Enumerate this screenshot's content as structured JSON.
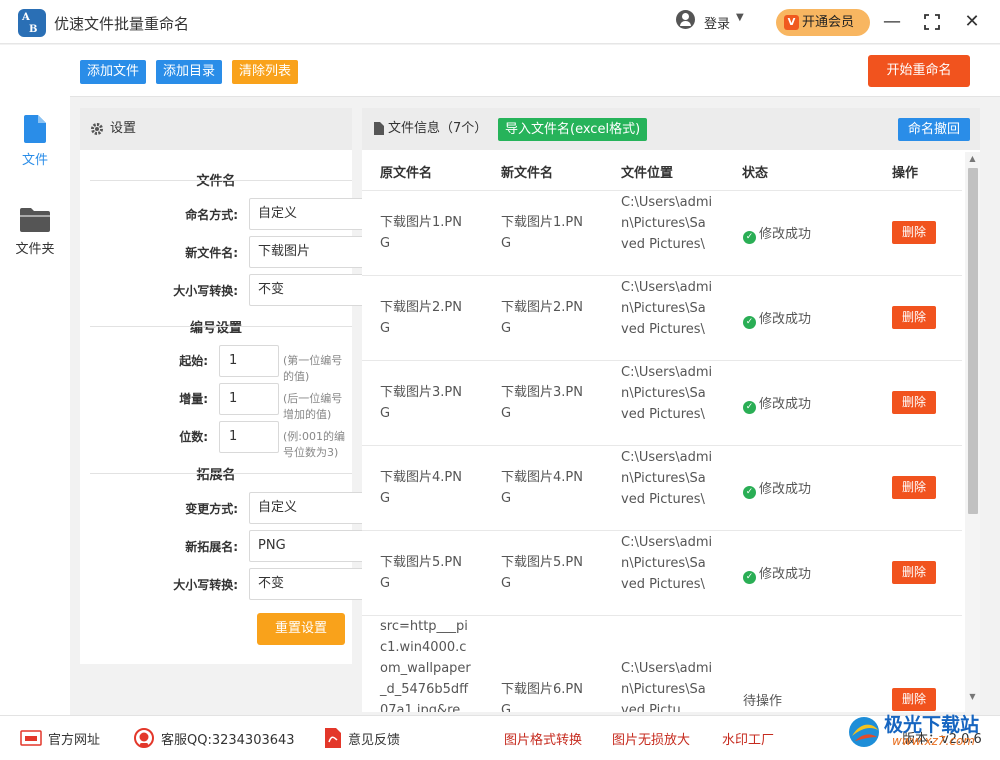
{
  "app": {
    "title": "优速文件批量重命名",
    "logo_text_top": "A",
    "logo_text_bottom": "B"
  },
  "header": {
    "login_label": "登录",
    "vip_label": "开通会员",
    "vip_icon_text": "V"
  },
  "sidebar": {
    "items": [
      {
        "label": "文件",
        "icon": "file-icon",
        "active": true
      },
      {
        "label": "文件夹",
        "icon": "folder-icon",
        "active": false
      }
    ]
  },
  "toolbar": {
    "add_file": "添加文件",
    "add_dir": "添加目录",
    "clear_list": "清除列表",
    "start": "开始重命名"
  },
  "settings": {
    "title": "设置",
    "filename_section": "文件名",
    "naming_mode_label": "命名方式:",
    "naming_mode_value": "自定义",
    "new_name_label": "新文件名:",
    "new_name_value": "下载图片",
    "case_label": "大小写转换:",
    "case_value": "不变",
    "number_section": "编号设置",
    "start_label": "起始:",
    "start_value": "1",
    "start_hint": "(第一位编号的值)",
    "step_label": "增量:",
    "step_value": "1",
    "step_hint": "(后一位编号增加的值)",
    "digits_label": "位数:",
    "digits_value": "1",
    "digits_hint": "(例:001的编号位数为3)",
    "ext_section": "拓展名",
    "ext_mode_label": "变更方式:",
    "ext_mode_value": "自定义",
    "new_ext_label": "新拓展名:",
    "new_ext_value": "PNG",
    "ext_case_label": "大小写转换:",
    "ext_case_value": "不变",
    "reset": "重置设置"
  },
  "files": {
    "title": "文件信息（7个）",
    "import_btn": "导入文件名(excel格式)",
    "undo_btn": "命名撤回",
    "headers": [
      "原文件名",
      "新文件名",
      "文件位置",
      "状态",
      "操作"
    ],
    "rows": [
      {
        "orig": "下载图片1.PNG",
        "new": "下载图片1.PNG",
        "loc": "C:\\Users\\admin\\Pictures\\Saved Pictures\\",
        "status": "修改成功",
        "action": "删除"
      },
      {
        "orig": "下载图片2.PNG",
        "new": "下载图片2.PNG",
        "loc": "C:\\Users\\admin\\Pictures\\Saved Pictures\\",
        "status": "修改成功",
        "action": "删除"
      },
      {
        "orig": "下载图片3.PNG",
        "new": "下载图片3.PNG",
        "loc": "C:\\Users\\admin\\Pictures\\Saved Pictures\\",
        "status": "修改成功",
        "action": "删除"
      },
      {
        "orig": "下载图片4.PNG",
        "new": "下载图片4.PNG",
        "loc": "C:\\Users\\admin\\Pictures\\Saved Pictures\\",
        "status": "修改成功",
        "action": "删除"
      },
      {
        "orig": "下载图片5.PNG",
        "new": "下载图片5.PNG",
        "loc": "C:\\Users\\admin\\Pictures\\Saved Pictures\\",
        "status": "修改成功",
        "action": "删除"
      },
      {
        "orig": "src=http___pic1.win4000.com_wallpaper_d_5476b5dff07a1.jpg&re",
        "new": "下载图片6.PNG",
        "loc": "C:\\Users\\admin\\Pictures\\Saved Pictu",
        "status": "待操作",
        "action": "删除"
      }
    ]
  },
  "footer": {
    "site": "官方网址",
    "qq": "客服QQ:3234303643",
    "feedback": "意见反馈",
    "convert": "图片格式转换",
    "enlarge": "图片无损放大",
    "watermark": "水印工厂",
    "version": "版本：v2.0.6"
  },
  "overlay_watermark": {
    "line1": "极光下载站",
    "line2": "www.xz7.com"
  },
  "colors": {
    "primary_blue": "#2a8de8",
    "orange": "#f9a21b",
    "red": "#f1531e",
    "green": "#26b35a"
  }
}
